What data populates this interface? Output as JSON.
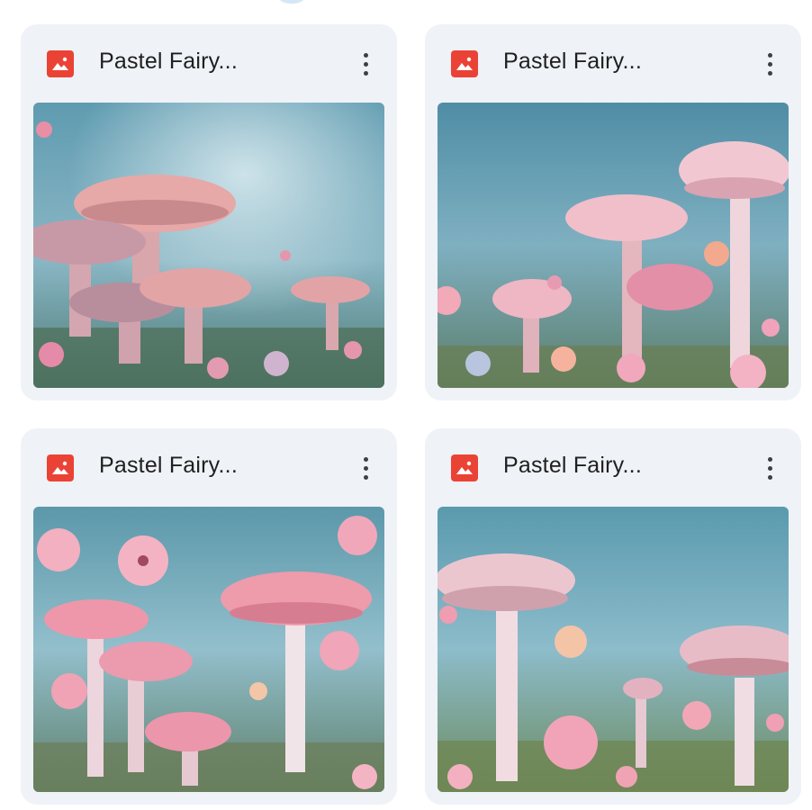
{
  "files": [
    {
      "name": "Pastel Fairy...",
      "icon": "image-file-icon",
      "menu_icon": "more-vert-icon"
    },
    {
      "name": "Pastel Fairy...",
      "icon": "image-file-icon",
      "menu_icon": "more-vert-icon"
    },
    {
      "name": "Pastel Fairy...",
      "icon": "image-file-icon",
      "menu_icon": "more-vert-icon"
    },
    {
      "name": "Pastel Fairy...",
      "icon": "image-file-icon",
      "menu_icon": "more-vert-icon"
    }
  ],
  "colors": {
    "card_background": "#eff2f7",
    "file_icon": "#ea4335",
    "title_text": "#1f1f1f"
  }
}
